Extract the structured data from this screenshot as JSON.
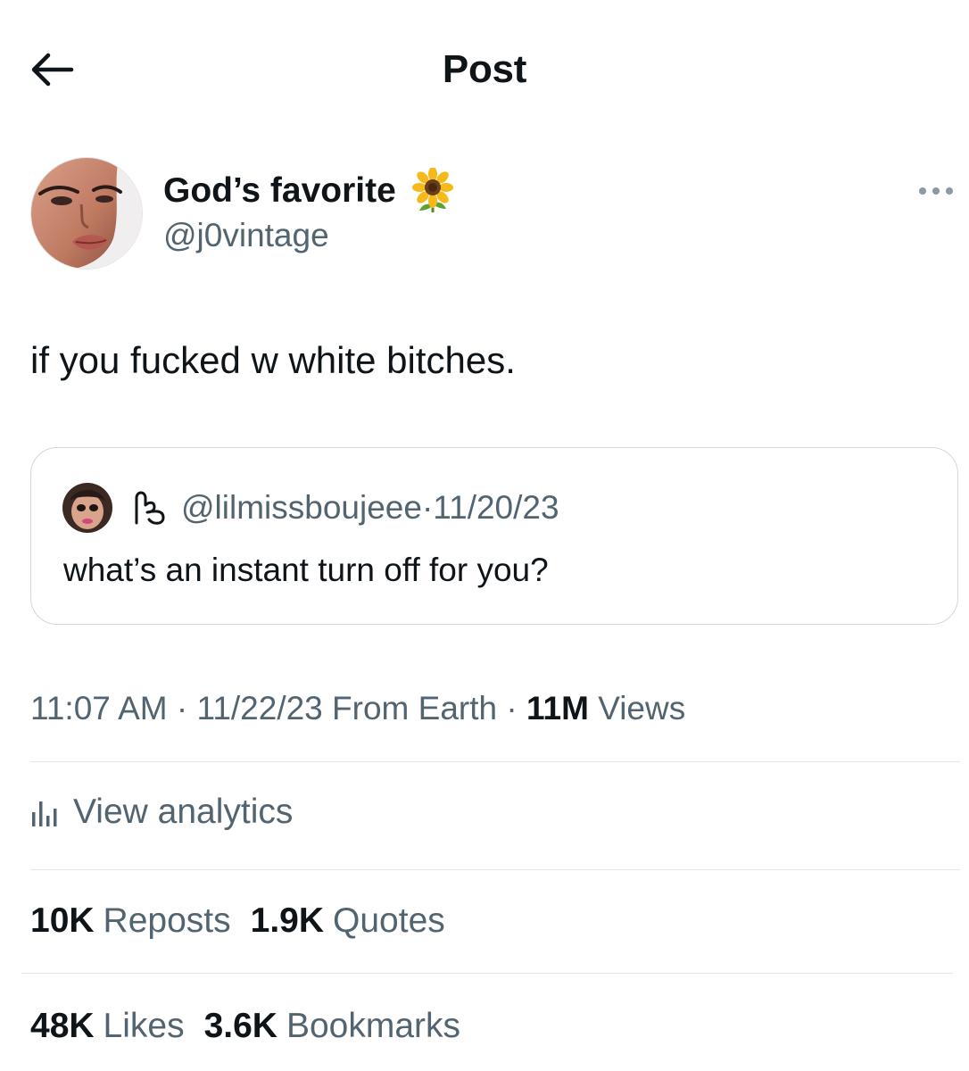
{
  "header": {
    "title": "Post",
    "back_icon": "arrow-left-icon"
  },
  "author": {
    "display_name": "God’s favorite",
    "emoji": "🌻",
    "handle": "@j0vintage",
    "more_icon": "more-horizontal-icon"
  },
  "tweet": {
    "text": "if you fucked w white bitches."
  },
  "quote": {
    "handle": "@lilmissboujeee",
    "separator": "·",
    "date": "11/20/23",
    "text": "what’s an instant turn off for you?",
    "badge_icon": "subscriber-badge-icon"
  },
  "meta": {
    "time": "11:07 AM",
    "sep1": "·",
    "date": "11/22/23",
    "location": "From Earth",
    "sep2": "·",
    "views_count": "11M",
    "views_label": "Views"
  },
  "analytics": {
    "label": "View analytics",
    "icon": "bar-chart-icon"
  },
  "stats": {
    "reposts_count": "10K",
    "reposts_label": "Reposts",
    "quotes_count": "1.9K",
    "quotes_label": "Quotes",
    "likes_count": "48K",
    "likes_label": "Likes",
    "bookmarks_count": "3.6K",
    "bookmarks_label": "Bookmarks"
  },
  "colors": {
    "text_primary": "#0f1419",
    "text_secondary": "#536471",
    "border": "#cfd9de",
    "divider": "#e1e8ed"
  }
}
